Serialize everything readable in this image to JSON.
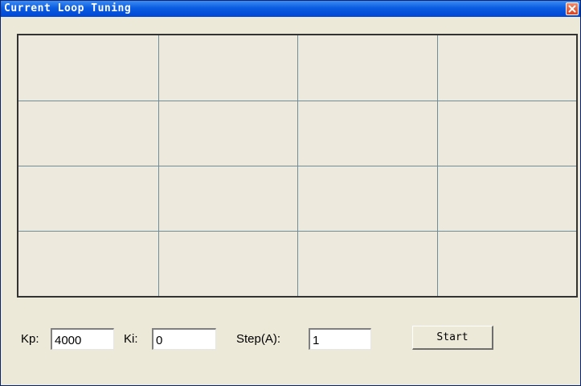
{
  "window": {
    "title": "Current Loop Tuning"
  },
  "plot": {
    "grid_columns": 4,
    "grid_rows": 4,
    "grid_color": "#6e8f99",
    "background": "#ede9dc"
  },
  "controls": {
    "kp_label": "Kp:",
    "kp_value": "4000",
    "ki_label": "Ki:",
    "ki_value": "0",
    "step_label": "Step(A):",
    "step_value": "1",
    "start_label": "Start"
  },
  "icons": {
    "close": "close-icon"
  },
  "colors": {
    "titlebar": "#0a5ce0",
    "close_button": "#d8431f",
    "window_background": "#ece9d8"
  }
}
